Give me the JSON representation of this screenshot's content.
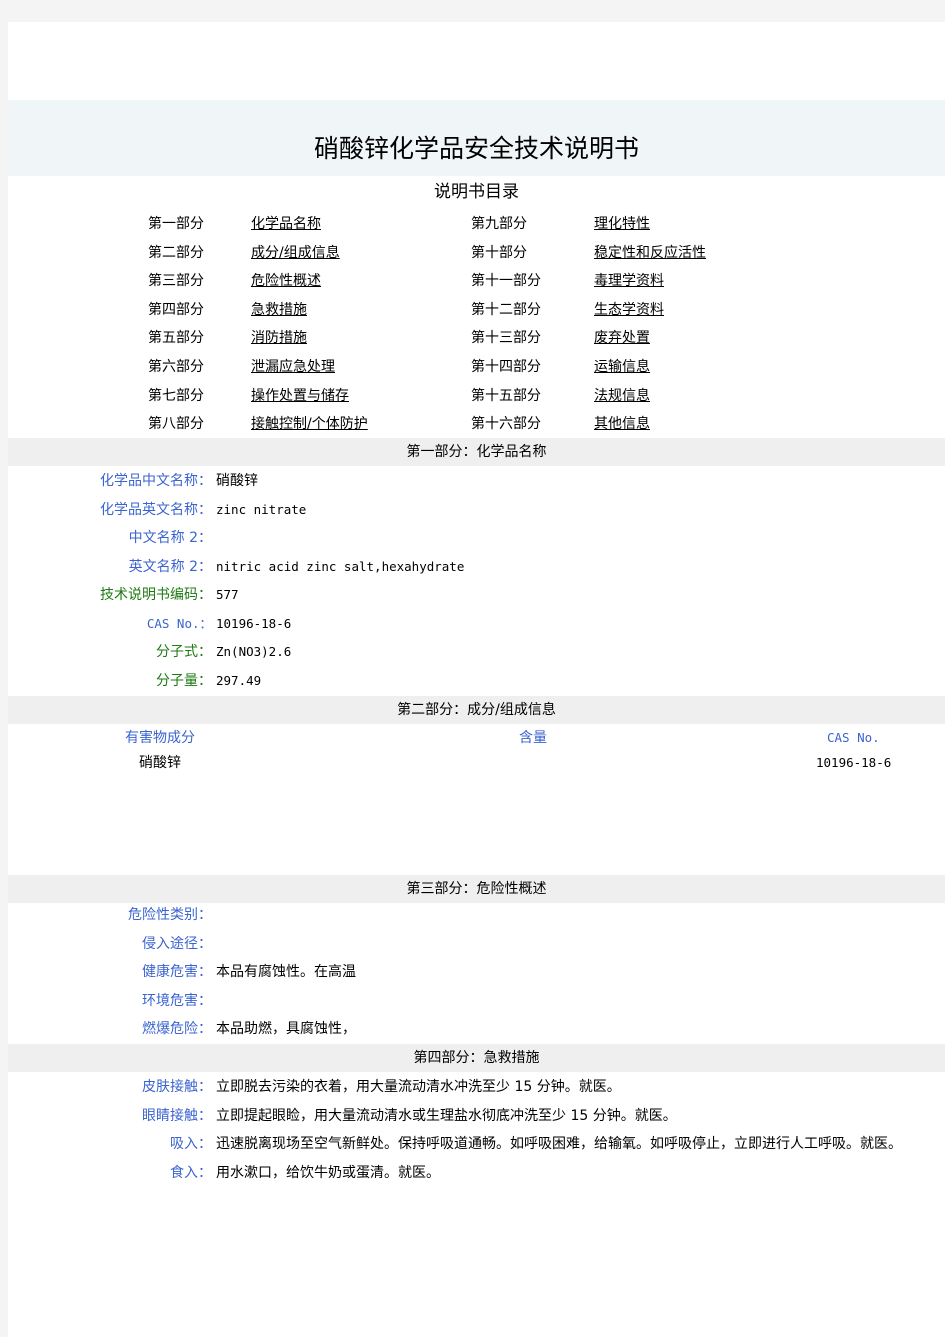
{
  "document": {
    "title": "硝酸锌化学品安全技术说明书",
    "toc_title": "说明书目录"
  },
  "toc": {
    "left": [
      {
        "part": "第一部分",
        "label": "化学品名称"
      },
      {
        "part": "第二部分",
        "label": "成分/组成信息"
      },
      {
        "part": "第三部分",
        "label": "危险性概述"
      },
      {
        "part": "第四部分",
        "label": "急救措施"
      },
      {
        "part": "第五部分",
        "label": "消防措施"
      },
      {
        "part": "第六部分",
        "label": "泄漏应急处理"
      },
      {
        "part": "第七部分",
        "label": "操作处置与储存"
      },
      {
        "part": "第八部分",
        "label": "接触控制/个体防护"
      }
    ],
    "right": [
      {
        "part": "第九部分",
        "label": "理化特性"
      },
      {
        "part": "第十部分",
        "label": "稳定性和反应活性"
      },
      {
        "part": "第十一部分",
        "label": "毒理学资料"
      },
      {
        "part": "第十二部分",
        "label": "生态学资料"
      },
      {
        "part": "第十三部分",
        "label": "废弃处置"
      },
      {
        "part": "第十四部分",
        "label": "运输信息"
      },
      {
        "part": "第十五部分",
        "label": "法规信息"
      },
      {
        "part": "第十六部分",
        "label": "其他信息"
      }
    ]
  },
  "section1": {
    "header": "第一部分：化学品名称",
    "rows": [
      {
        "label": "化学品中文名称：",
        "value": "硝酸锌"
      },
      {
        "label": "化学品英文名称：",
        "value": "zinc nitrate"
      },
      {
        "label": "中文名称 2：",
        "value": ""
      },
      {
        "label": "英文名称 2：",
        "value": "nitric acid zinc salt,hexahydrate"
      },
      {
        "label": "技术说明书编码：",
        "value": "577"
      },
      {
        "label": "CAS No.：",
        "value": "10196-18-6"
      },
      {
        "label": "分子式：",
        "value": "Zn(NO3)2.6"
      },
      {
        "label": "分子量：",
        "value": "297.49"
      }
    ]
  },
  "section2": {
    "header": "第二部分：成分/组成信息",
    "columns": [
      "有害物成分",
      "含量",
      "CAS No."
    ],
    "rows": [
      {
        "component": "硝酸锌",
        "content": "",
        "cas": "10196-18-6"
      }
    ]
  },
  "section3": {
    "header": "第三部分：危险性概述",
    "rows": [
      {
        "label": "危险性类别：",
        "value": ""
      },
      {
        "label": "侵入途径：",
        "value": ""
      },
      {
        "label": "健康危害：",
        "value": "本品有腐蚀性。在高温"
      },
      {
        "label": "环境危害：",
        "value": ""
      },
      {
        "label": "燃爆危险：",
        "value": "本品助燃，具腐蚀性，"
      }
    ]
  },
  "section4": {
    "header": "第四部分：急救措施",
    "rows": [
      {
        "label": "皮肤接触：",
        "value": "立即脱去污染的衣着，用大量流动清水冲洗至少 15 分钟。就医。"
      },
      {
        "label": "眼睛接触：",
        "value": "立即提起眼睑，用大量流动清水或生理盐水彻底冲洗至少 15 分钟。就医。"
      },
      {
        "label": "吸入：",
        "value": "迅速脱离现场至空气新鲜处。保持呼吸道通畅。如呼吸困难，给输氧。如呼吸停止，立即进行人工呼吸。就医。"
      },
      {
        "label": "食入：",
        "value": "用水漱口，给饮牛奶或蛋清。就医。"
      }
    ]
  },
  "colors": {
    "label_blue": "#3b64d0",
    "label_green": "#1e7a12",
    "section_bar": "#efefef",
    "title_band": "#f0f5f8"
  }
}
